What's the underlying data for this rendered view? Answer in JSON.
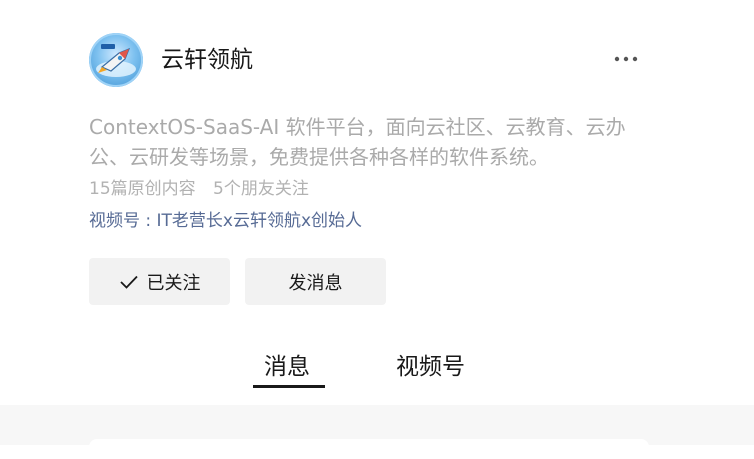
{
  "profile": {
    "name": "云轩领航",
    "avatar_icon": "rocket-avatar-icon",
    "description": "ContextOS-SaaS-AI 软件平台，面向云社区、云教育、云办公、云研发等场景，免费提供各种各样的软件系统。",
    "stats": {
      "articles": "15篇原创内容",
      "friends": "5个朋友关注"
    },
    "channel": "视频号 : IT老营长x云轩领航x创始人"
  },
  "actions": {
    "follow_label": "已关注",
    "message_label": "发消息"
  },
  "tabs": [
    {
      "label": "消息",
      "active": true
    },
    {
      "label": "视频号",
      "active": false
    }
  ],
  "colors": {
    "link": "#576b95",
    "muted": "#aaaaaa",
    "button_bg": "#f2f2f2"
  }
}
